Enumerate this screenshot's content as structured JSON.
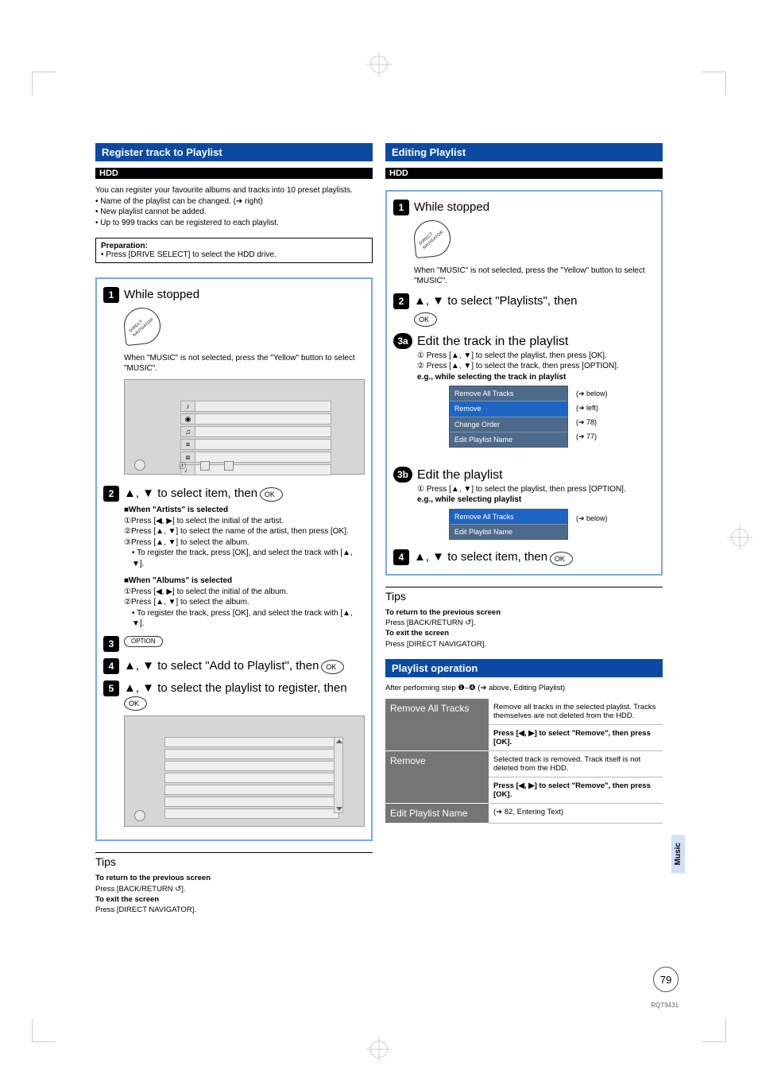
{
  "left": {
    "section_title": "Register track to Playlist",
    "hdd": "HDD",
    "intro_line": "You can register your favourite albums and tracks into 10 preset playlists.",
    "intro_bullets": [
      "• Name of the playlist can be changed. (➔ right)",
      "• New playlist cannot be added.",
      "• Up to 999 tracks can be registered to each playlist."
    ],
    "prep_title": "Preparation:",
    "prep_text": "• Press [DRIVE SELECT] to select the HDD drive.",
    "s1_title": "While stopped",
    "s1_note": "When \"MUSIC\" is not selected, press the \"Yellow\" button to select \"MUSIC\".",
    "s2_title_a": "▲, ▼ to select item, then",
    "s2_ok": "OK",
    "s2_h_artists": "■When \"Artists\" is selected",
    "s2_art_1": "①Press [◀, ▶] to select the initial of the artist.",
    "s2_art_2": "②Press [▲, ▼] to select the name of the artist, then press [OK].",
    "s2_art_3": "③Press [▲, ▼] to select the album.",
    "s2_art_4": "• To register the track, press [OK], and select the track with [▲, ▼].",
    "s2_h_albums": "■When \"Albums\" is selected",
    "s2_alb_1": "①Press [◀, ▶] to select the initial of the album.",
    "s2_alb_2": "②Press [▲, ▼] to select the album.",
    "s2_alb_3": "• To register the track, press [OK], and select the track with [▲, ▼].",
    "s3_option": "OPTION",
    "s4_title_a": "▲, ▼ to select \"Add to Playlist\", then",
    "s4_ok": "OK",
    "s5_title_a": "▲, ▼ to select the playlist to register, then",
    "s5_ok": "OK",
    "tips_h": "Tips",
    "tips_prev_b": "To return to the previous screen",
    "tips_prev_t": "Press [BACK/RETURN ↺].",
    "tips_exit_b": "To exit the screen",
    "tips_exit_t": "Press [DIRECT NAVIGATOR]."
  },
  "right": {
    "section_title": "Editing Playlist",
    "hdd": "HDD",
    "s1_title": "While stopped",
    "s1_note": "When \"MUSIC\" is not selected, press the \"Yellow\" button to select \"MUSIC\".",
    "s2_title_a": "▲, ▼ to select \"Playlists\", then",
    "s2_ok": "OK",
    "s3a_num": "3a",
    "s3a_title": "Edit the track in the playlist",
    "s3a_1": "① Press [▲, ▼] to select the playlist, then press [OK].",
    "s3a_2": "② Press [▲, ▼] to select the track, then press [OPTION].",
    "s3a_eg": "e.g., while selecting the track in playlist",
    "menu3a": [
      "Remove All Tracks",
      "Remove",
      "Change Order",
      "Edit Playlist Name"
    ],
    "menu3a_labels": [
      "(➔ below)",
      "(➔ left)",
      "(➔ 78)",
      "(➔ 77)"
    ],
    "s3b_num": "3b",
    "s3b_title": "Edit the playlist",
    "s3b_1": "① Press [▲, ▼] to select the playlist, then press [OPTION].",
    "s3b_eg": "e.g., while selecting playlist",
    "menu3b": [
      "Remove All Tracks",
      "Edit Playlist Name"
    ],
    "menu3b_label": "(➔ below)",
    "s4_title_a": "▲, ▼ to select item, then",
    "s4_ok": "OK",
    "tips_h": "Tips",
    "tips_prev_b": "To return to the previous screen",
    "tips_prev_t": "Press [BACK/RETURN ↺].",
    "tips_exit_b": "To exit the screen",
    "tips_exit_t": "Press [DIRECT NAVIGATOR].",
    "op_header": "Playlist operation",
    "op_after": "After performing step ❶–❹ (➔ above, Editing Playlist)",
    "op_rows": [
      {
        "label": "Remove All Tracks",
        "desc": "Remove all tracks in the selected playlist. Tracks themselves are not deleted from the HDD.",
        "action": "Press [◀, ▶] to select \"Remove\", then press [OK]."
      },
      {
        "label": "Remove",
        "desc": "Selected track is removed. Track itself is not deleted from the HDD.",
        "action": "Press [◀, ▶] to select \"Remove\", then press [OK]."
      },
      {
        "label": "Edit Playlist Name",
        "desc": "(➔ 82, Entering Text)",
        "action": ""
      }
    ]
  },
  "side_tab": "Music",
  "page_no": "79",
  "rqt": "RQT9431"
}
